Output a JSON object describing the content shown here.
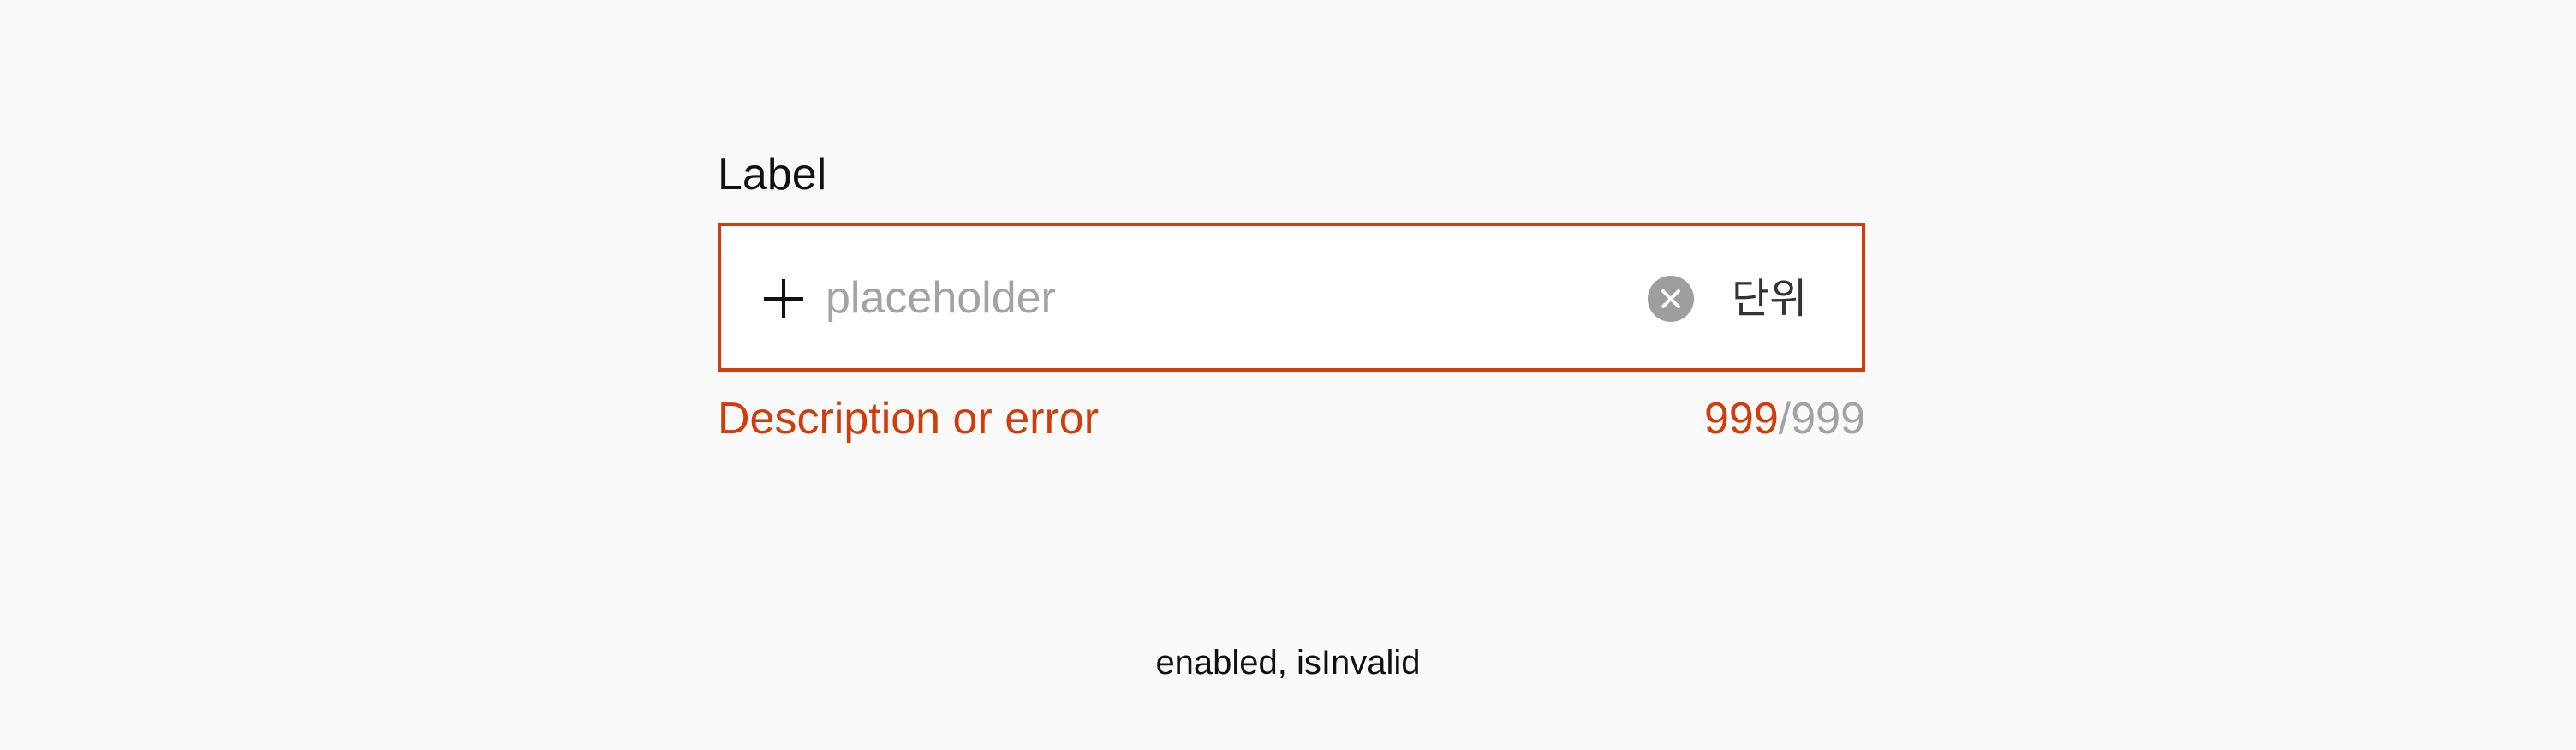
{
  "field": {
    "label": "Label",
    "placeholder": "placeholder",
    "value": "",
    "unit": "단위",
    "leading_icon": "plus-icon",
    "clear_icon": "clear-circle-icon",
    "description": "Description or error",
    "counter": {
      "current": "999",
      "separator": "/",
      "max": "999"
    }
  },
  "state_caption": "enabled, isInvalid",
  "colors": {
    "error": "#d23c0b",
    "placeholder": "#a3a3a3",
    "background": "#fafafa",
    "clear_button": "#9e9e9e"
  }
}
